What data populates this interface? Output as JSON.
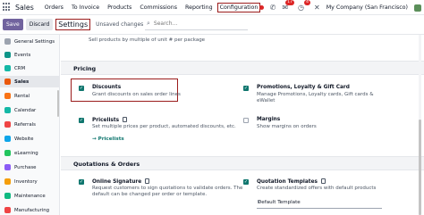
{
  "topbar": {
    "app_name": "Sales",
    "nav": [
      "Orders",
      "To Invoice",
      "Products",
      "Commissions",
      "Reporting",
      "Configuration"
    ],
    "messages_badge": "17",
    "activities_badge": "4",
    "company": "My Company (San Francisco)"
  },
  "control": {
    "save": "Save",
    "discard": "Discard",
    "title": "Settings",
    "unsaved": "Unsaved changes",
    "search_placeholder": "Search..."
  },
  "sidebar": {
    "items": [
      {
        "label": "General Settings",
        "color": "#9ca3af"
      },
      {
        "label": "Events",
        "color": "#0d9488"
      },
      {
        "label": "CRM",
        "color": "#14b8a6"
      },
      {
        "label": "Sales",
        "color": "#ea580c"
      },
      {
        "label": "Rental",
        "color": "#f97316"
      },
      {
        "label": "Calendar",
        "color": "#14b8a6"
      },
      {
        "label": "Referrals",
        "color": "#ef4444"
      },
      {
        "label": "Website",
        "color": "#0ea5e9"
      },
      {
        "label": "eLearning",
        "color": "#22c55e"
      },
      {
        "label": "Purchase",
        "color": "#8b5cf6"
      },
      {
        "label": "Inventory",
        "color": "#f59e0b"
      },
      {
        "label": "Maintenance",
        "color": "#10b981"
      },
      {
        "label": "Manufacturing",
        "color": "#ef4444"
      }
    ]
  },
  "main": {
    "top_desc": "Sell products by multiple of unit # per package",
    "pricing": {
      "heading": "Pricing",
      "discounts_title": "Discounts",
      "discounts_desc": "Grant discounts on sales order lines",
      "promotions_title": "Promotions, Loyalty & Gift Card",
      "promotions_desc1": "Manage Promotions, Loyalty cards, Gift cards &",
      "promotions_desc2": "eWallet",
      "pricelists_title": "Pricelists",
      "pricelists_desc": "Set multiple prices per product, automated discounts, etc.",
      "pricelists_link": "Pricelists",
      "margins_title": "Margins",
      "margins_desc": "Show margins on orders"
    },
    "quotations": {
      "heading": "Quotations & Orders",
      "sig_title": "Online Signature",
      "sig_desc1": "Request customers to sign quotations to validate orders. The",
      "sig_desc2": "default can be changed per order or template.",
      "tmpl_title": "Quotation Templates",
      "tmpl_desc": "Create standardized offers with default products",
      "default_template": "Default Template"
    }
  }
}
